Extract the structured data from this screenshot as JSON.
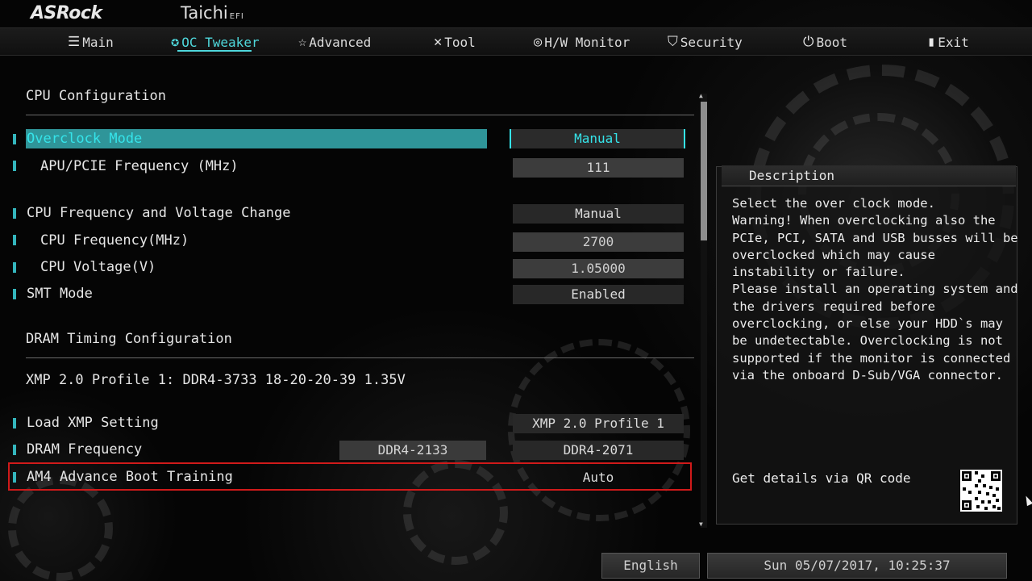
{
  "brand": {
    "logo": "ASRock",
    "model": "Taichi",
    "suffix": "EFI"
  },
  "nav": {
    "tabs": [
      {
        "label": "Main",
        "icon": "list-icon"
      },
      {
        "label": "OC Tweaker",
        "icon": "rocket-icon",
        "active": true
      },
      {
        "label": "Advanced",
        "icon": "star-icon"
      },
      {
        "label": "Tool",
        "icon": "tools-icon"
      },
      {
        "label": "H/W Monitor",
        "icon": "monitor-icon"
      },
      {
        "label": "Security",
        "icon": "shield-icon"
      },
      {
        "label": "Boot",
        "icon": "power-icon"
      },
      {
        "label": "Exit",
        "icon": "door-exit-icon"
      }
    ]
  },
  "main": {
    "section_cpu": "CPU Configuration",
    "items": {
      "overclock_mode": {
        "label": "Overclock Mode",
        "value": "Manual"
      },
      "apu_pcie_freq": {
        "label": "APU/PCIE Frequency (MHz)",
        "value": "111"
      },
      "cpu_freq_voltage_change": {
        "label": "CPU Frequency and Voltage Change",
        "value": "Manual"
      },
      "cpu_frequency": {
        "label": "CPU Frequency(MHz)",
        "value": "2700"
      },
      "cpu_voltage": {
        "label": "CPU Voltage(V)",
        "value": "1.05000"
      },
      "smt_mode": {
        "label": "SMT Mode",
        "value": "Enabled"
      },
      "load_xmp": {
        "label": "Load XMP Setting",
        "value": "XMP 2.0 Profile 1"
      },
      "dram_frequency": {
        "label": "DRAM Frequency",
        "current": "DDR4-2133",
        "value": "DDR4-2071"
      },
      "am4_boot_training": {
        "label": "AM4 Advance Boot Training",
        "value": "Auto"
      }
    },
    "section_dram": "DRAM Timing Configuration",
    "xmp_profile_info": "XMP 2.0 Profile 1: DDR4-3733 18-20-20-39 1.35V"
  },
  "description": {
    "title": "Description",
    "body": "Select the over clock mode.\nWarning! When overclocking also the\nPCIe, PCI, SATA and USB busses will be\noverclocked which may cause\ninstability or failure.\nPlease install an operating system and\nthe drivers required before\noverclocking, or else your HDD`s may\nbe undetectable. Overclocking is not\nsupported if the monitor is connected\nvia the onboard D-Sub/VGA connector.",
    "qr_label": "Get details via QR code"
  },
  "footer": {
    "language": "English",
    "datetime": "Sun 05/07/2017, 10:25:37"
  },
  "colors": {
    "accent": "#35e4ea",
    "selected_row": "#2f9599",
    "highlight_box": "#d01a1a"
  }
}
